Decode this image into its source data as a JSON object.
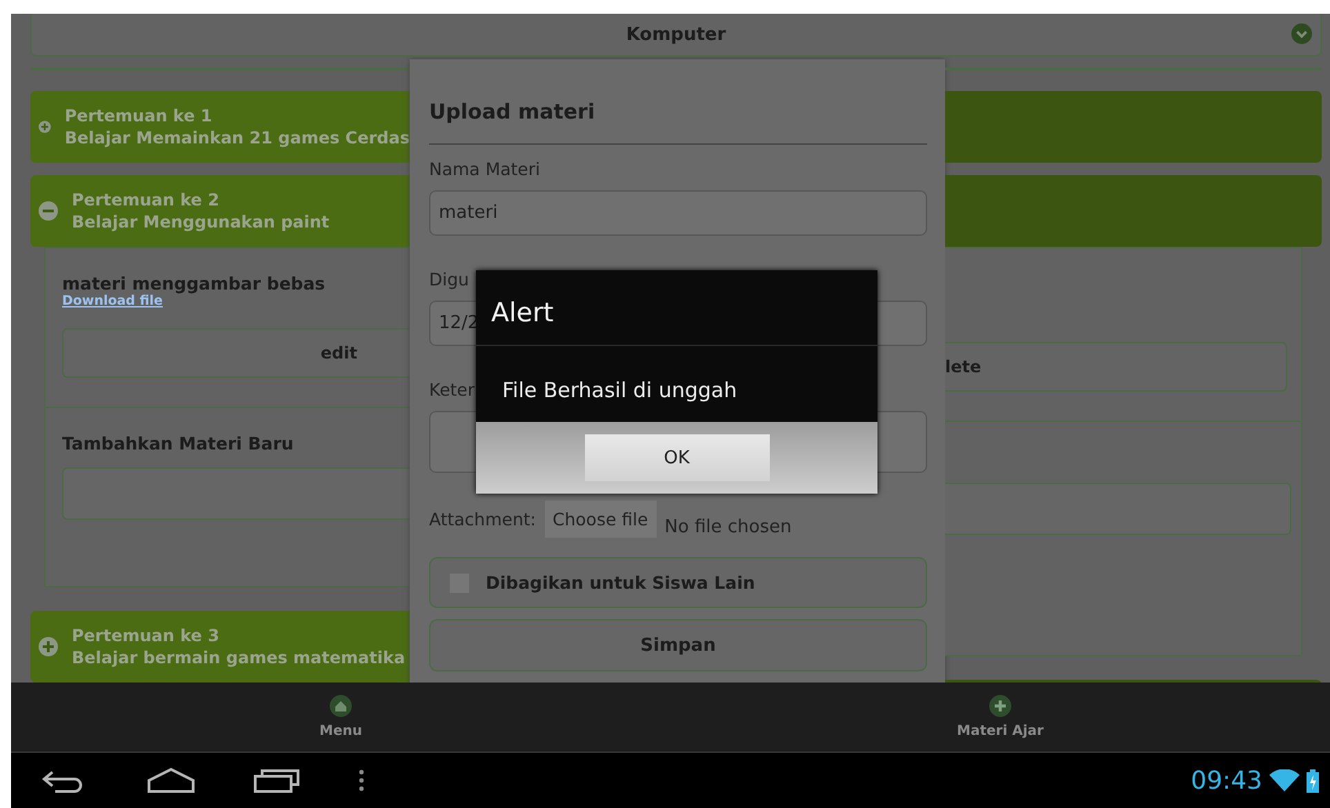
{
  "course_header": {
    "title": "Komputer"
  },
  "meetings": [
    {
      "title": "Pertemuan ke 1",
      "subtitle": "Belajar Memainkan 21 games Cerdas",
      "expanded": false
    },
    {
      "title": "Pertemuan ke 2",
      "subtitle": "Belajar Menggunakan paint",
      "expanded": true
    },
    {
      "title": "Pertemuan ke 3",
      "subtitle": "Belajar bermain games matematika",
      "expanded": false
    }
  ],
  "expanded_content": {
    "material": {
      "name": "materi menggambar bebas",
      "link": "Download file",
      "edit_button": "edit",
      "delete_button": "lete"
    },
    "new_material_label": "Tambahkan Materi Baru"
  },
  "upload_dialog": {
    "title": "Upload materi",
    "name_label": "Nama Materi",
    "name_value": "materi",
    "date_label": "Digu",
    "date_value": "12/2",
    "note_label": "Keter",
    "attachment_label": "Attachment:",
    "choose_button": "Choose file",
    "file_status": "No file chosen",
    "share_checkbox": {
      "label": "Dibagikan untuk Siswa Lain",
      "checked": false
    },
    "save_button": "Simpan"
  },
  "alert": {
    "title": "Alert",
    "message": "File Berhasil di unggah",
    "button": "OK"
  },
  "action_bar": [
    {
      "label": "Menu",
      "kind": "home"
    },
    {
      "label": "Materi Ajar",
      "kind": "add"
    }
  ],
  "nav_bar": {
    "time": "09:43"
  }
}
